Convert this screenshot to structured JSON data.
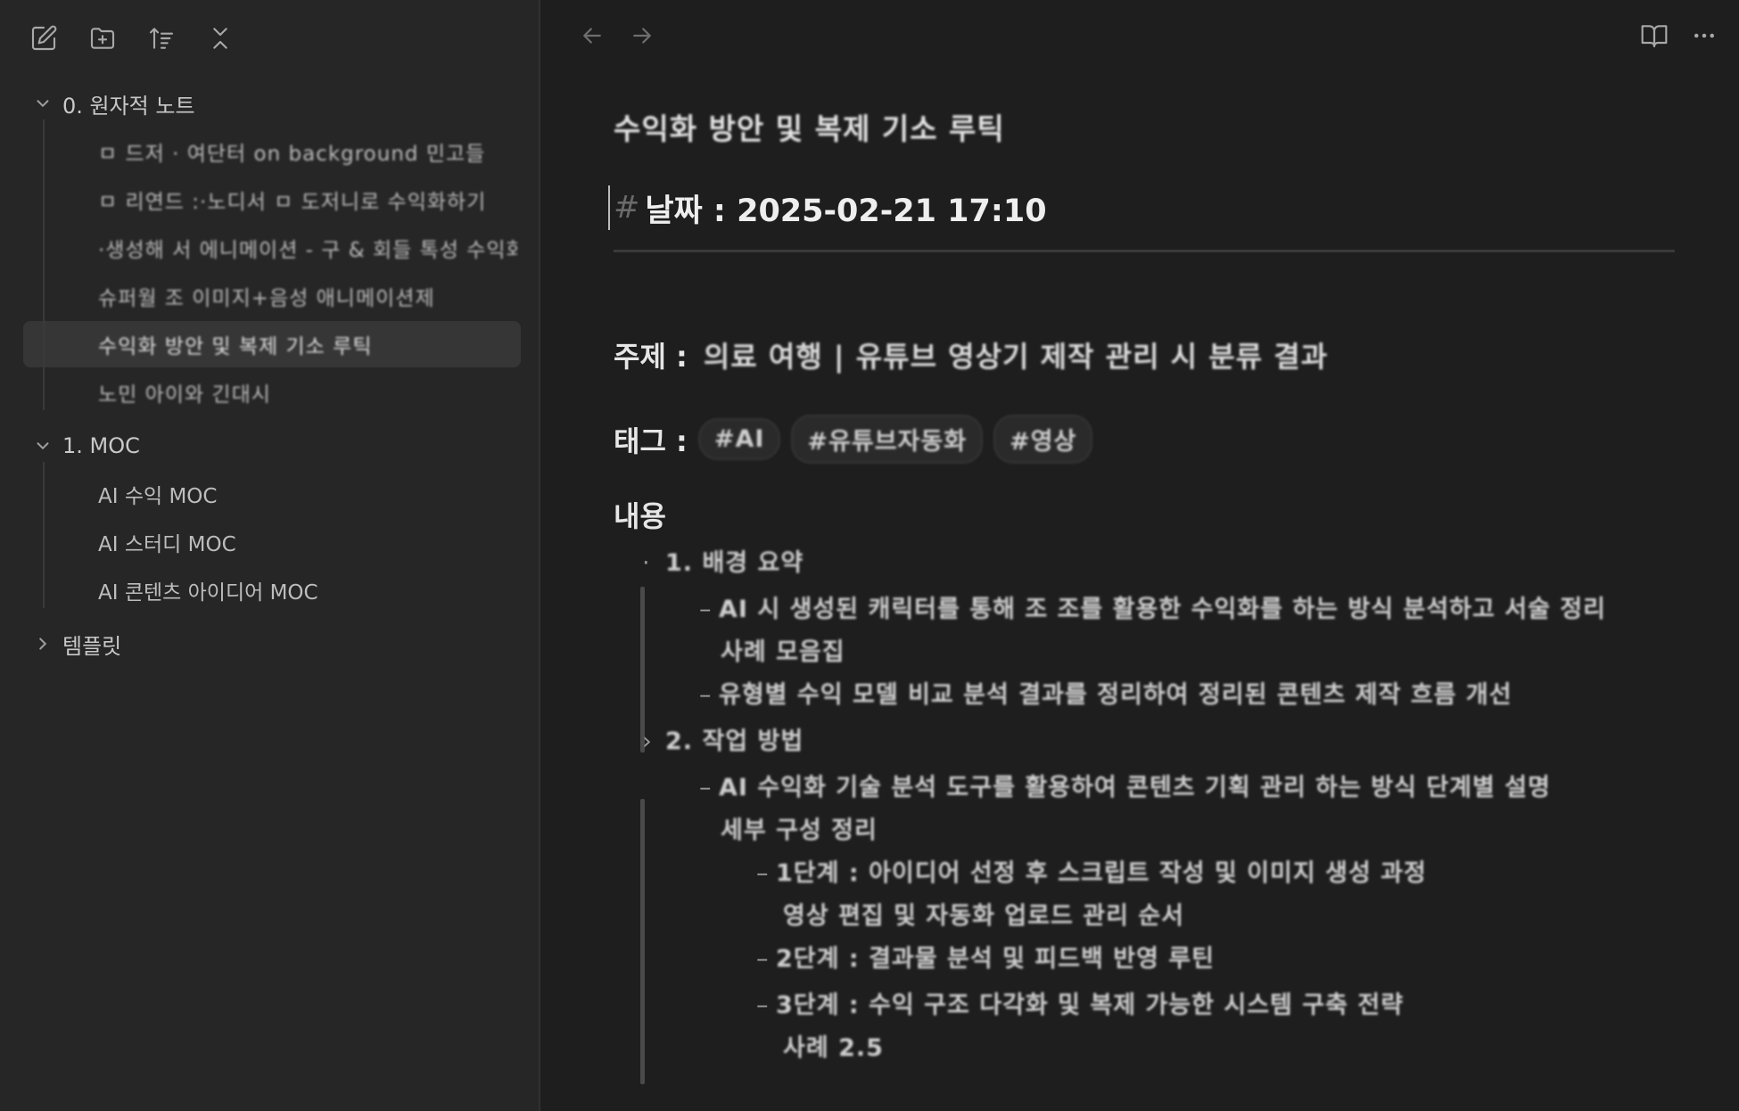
{
  "sidebar": {
    "toolbar": [
      {
        "name": "new-note-icon"
      },
      {
        "name": "new-folder-icon"
      },
      {
        "name": "sort-icon"
      },
      {
        "name": "collapse-all-icon"
      }
    ],
    "folders": [
      {
        "label": "0. 원자적 노트",
        "expanded": true,
        "files": [
          {
            "label": "ㅁ 드저 · 여단터 on background 민고들",
            "active": false
          },
          {
            "label": "ㅁ 리연드 :·노디서 ㅁ 도저니로 수익화하기",
            "active": false
          },
          {
            "label": "·생성해 서 에니메이션 - 구 & 회들 톡성 수익화",
            "active": false
          },
          {
            "label": "슈퍼월 조 이미지+음성 애니메이션제",
            "active": false
          },
          {
            "label": "수익화 방안 및 복제 기소 루틱",
            "active": true
          },
          {
            "label": "노민 아이와 긴대시",
            "active": false
          }
        ]
      },
      {
        "label": "1. MOC",
        "expanded": true,
        "files": [
          {
            "label": "AI 수익 MOC",
            "active": false
          },
          {
            "label": "AI 스터디 MOC",
            "active": false
          },
          {
            "label": "AI 콘텐츠 아이디어 MOC",
            "active": false
          }
        ]
      },
      {
        "label": "템플릿",
        "expanded": false,
        "files": []
      }
    ]
  },
  "main": {
    "nav": {
      "back": "←",
      "forward": "→"
    },
    "doc": {
      "title": "수익화 방안 및 복제 기소 루틱",
      "heading_hash": "#",
      "heading": "날짜 : 2025-02-21 17:10",
      "subject_label": "주제 :",
      "subject_value": "의료 여행 | 유튜브 영상기 제작 관리 시 분류 결과",
      "tags_label": "태그 :",
      "tags": [
        "#AI",
        "#유튜브자동화",
        "#영상"
      ],
      "content_label": "내용",
      "outline": [
        {
          "level": 1,
          "bullet": "·",
          "text": "1. 배경 요약"
        },
        {
          "level": 2,
          "bullet": "–",
          "text": "AI 시 생성된 캐릭터를 통해 조 조를 활용한 수익화를 하는 방식 분석하고 서술 정리"
        },
        {
          "cont": true,
          "text": "사례 모음집"
        },
        {
          "level": 2,
          "bullet": "–",
          "text": "유형별 수익 모델 비교 분석 결과를 정리하여 정리된 콘텐츠 제작 흐름 개선"
        },
        {
          "level": 1,
          "bullet": "›",
          "text": "2. 작업 방법"
        },
        {
          "level": 2,
          "bullet": "–",
          "text": "AI 수익화 기술 분석 도구를 활용하여 콘텐츠 기획 관리 하는 방식 단계별 설명"
        },
        {
          "cont": true,
          "text": "세부 구성 정리"
        },
        {
          "level": 3,
          "bullet": "–",
          "text": "1단계 : 아이디어 선정 후 스크립트 작성 및 이미지 생성 과정"
        },
        {
          "cont3": true,
          "text": "영상 편집 및 자동화 업로드 관리 순서"
        },
        {
          "level": 3,
          "bullet": "–",
          "text": "2단계 : 결과물 분석 및 피드백 반영 루틴"
        },
        {
          "level": 3,
          "bullet": "–",
          "text": "3단계 : 수익 구조 다각화 및 복제 가능한 시스템 구축 전략"
        },
        {
          "cont3": true,
          "text": "사례 2.5"
        }
      ]
    }
  },
  "icons": {
    "read_mode": "book-open-icon",
    "more": "more-options-icon"
  }
}
